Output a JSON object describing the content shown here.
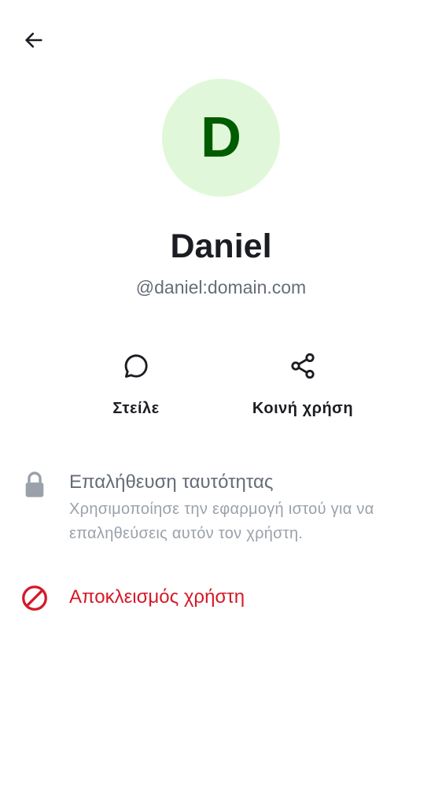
{
  "nav": {
    "back_icon": "arrow-left-icon"
  },
  "profile": {
    "avatar_initial": "D",
    "display_name": "Daniel",
    "user_id": "@daniel:domain.com",
    "avatar_bg": "#e0f8d9",
    "avatar_fg": "#005c00"
  },
  "actions": [
    {
      "label": "Στείλε",
      "icon": "chat-bubble-icon"
    },
    {
      "label": "Κοινή χρήση",
      "icon": "share-icon"
    }
  ],
  "verification": {
    "icon": "lock-icon",
    "title": "Επαλήθευση ταυτότητας",
    "description": "Χρησιμοποίησε την εφαρμογή ιστού για να επαληθεύσεις αυτόν τον χρήστη."
  },
  "block": {
    "icon": "block-icon",
    "label": "Αποκλεισμός χρήστη",
    "color": "#d51928"
  }
}
